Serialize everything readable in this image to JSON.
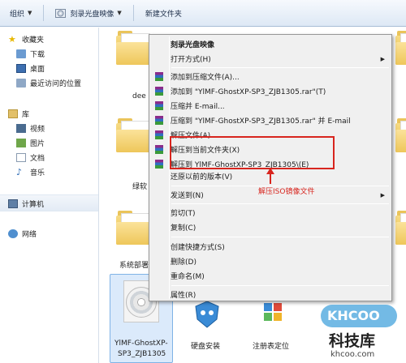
{
  "toolbar": {
    "organize": "组织",
    "burn": "刻录光盘映像",
    "new_folder": "新建文件夹"
  },
  "nav": {
    "favorites": "收藏夹",
    "downloads": "下载",
    "desktop": "桌面",
    "recent": "最近访问的位置",
    "libraries": "库",
    "videos": "视频",
    "pictures": "图片",
    "documents": "文档",
    "music": "音乐",
    "computer": "计算机",
    "network": "网络"
  },
  "content": {
    "folder_label_1": "dee",
    "folder_label_2": "绿软",
    "folder_label_3": "系统部署",
    "iso_file_line1": "YlMF-GhostXP-",
    "iso_file_line2": "SP3_ZJB1305",
    "app_label_1": "硬盘安装",
    "app_label_2": "注册表定位"
  },
  "context_menu": {
    "items": [
      "刻录光盘映像",
      "打开方式(H)",
      "添加到压缩文件(A)...",
      "添加到 \"YlMF-GhostXP-SP3_ZJB1305.rar\"(T)",
      "压缩并 E-mail...",
      "压缩到 \"YlMF-GhostXP-SP3_ZJB1305.rar\" 并 E-mail",
      "解压文件(A)...",
      "解压到当前文件夹(X)",
      "解压到 YlMF-GhostXP-SP3_ZJB1305\\(E)",
      "还原以前的版本(V)",
      "发送到(N)",
      "剪切(T)",
      "复制(C)",
      "创建快捷方式(S)",
      "删除(D)",
      "重命名(M)",
      "属性(R)"
    ]
  },
  "annotation": "解压ISO镜像文件",
  "watermark": {
    "logo": "KHCOO",
    "name": "科技库",
    "url": "khcoo.com"
  },
  "colors": {
    "highlight_red": "#d8251e",
    "selection_blue": "#dbeafb"
  }
}
